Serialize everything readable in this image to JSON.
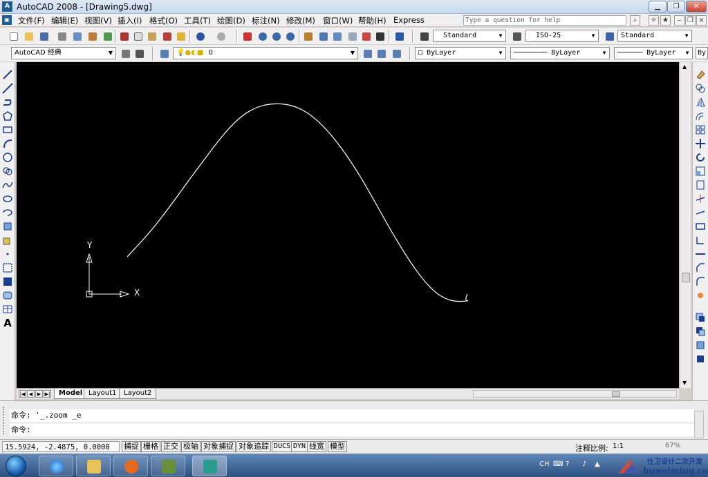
{
  "window": {
    "app_icon_text": "A",
    "title": "AutoCAD 2008 - [Drawing5.dwg]"
  },
  "menu": [
    "文件(F)",
    "编辑(E)",
    "视图(V)",
    "插入(I)",
    "格式(O)",
    "工具(T)",
    "绘图(D)",
    "标注(N)",
    "修改(M)",
    "窗口(W)",
    "帮助(H)",
    "Express"
  ],
  "help_search": {
    "placeholder": "Type a question for help"
  },
  "styles": {
    "text_style": "Standard",
    "dim_style": "ISO-25",
    "table_style": "Standard"
  },
  "workspace": "AutoCAD 经典",
  "layer": {
    "current": "0"
  },
  "properties": {
    "color": "ByLayer",
    "linetype": "ByLayer",
    "lineweight": "ByLayer",
    "plotstyle_fragment": "By"
  },
  "ucs": {
    "x_label": "X",
    "y_label": "Y"
  },
  "layout_tabs": [
    {
      "label": "Model",
      "active": true
    },
    {
      "label": "Layout1",
      "active": false
    },
    {
      "label": "Layout2",
      "active": false
    }
  ],
  "command": {
    "history": "命令: '_.zoom _e",
    "prompt": "命令:"
  },
  "status": {
    "coordinates": "15.5924, -2.4875, 0.0000",
    "toggles": [
      "捕捉",
      "栅格",
      "正交",
      "极轴",
      "对象捕捉",
      "对象追踪",
      "DUCS",
      "DYN",
      "线宽",
      "模型"
    ],
    "annotation_scale_label": "注释比例:",
    "annotation_scale_value": "1:1"
  },
  "tray": {
    "language": "CH",
    "zoom_badge": "67%"
  },
  "watermark": {
    "line1": "仕卫设计二次开发",
    "line2": "huweiming.com"
  },
  "colors": {
    "canvas": "#000000",
    "curve": "#ffffff",
    "taskbar": "#2d4f7e",
    "window_chrome": "#f0f0f0"
  }
}
